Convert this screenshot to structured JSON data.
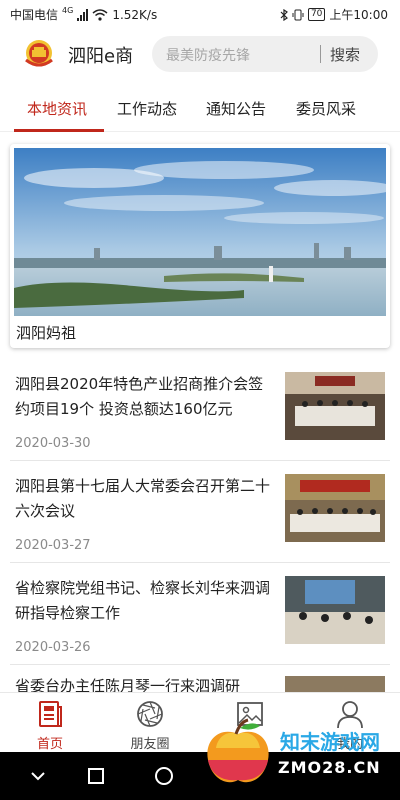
{
  "status_bar": {
    "carrier": "中国电信",
    "network": "4G",
    "speed": "1.52K/s",
    "battery": "70",
    "time": "上午10:00",
    "icons": [
      "signal-icon",
      "wifi-icon",
      "bluetooth-icon",
      "vibrate-icon",
      "battery-icon"
    ]
  },
  "header": {
    "app_name": "泗阳e商",
    "search_placeholder": "最美防疫先锋",
    "search_button": "搜索"
  },
  "tabs": [
    {
      "label": "本地资讯",
      "active": true
    },
    {
      "label": "工作动态",
      "active": false
    },
    {
      "label": "通知公告",
      "active": false
    },
    {
      "label": "委员风采",
      "active": false
    }
  ],
  "featured": {
    "caption": "泗阳妈祖"
  },
  "news": [
    {
      "title": "泗阳县2020年特色产业招商推介会签约项目19个 投资总额达160亿元",
      "date": "2020-03-30"
    },
    {
      "title": "泗阳县第十七届人大常委会召开第二十六次会议",
      "date": "2020-03-27"
    },
    {
      "title": "省检察院党组书记、检察长刘华来泗调研指导检察工作",
      "date": "2020-03-26"
    },
    {
      "title": "省委台办主任陈月琴一行来泗调研",
      "date": ""
    }
  ],
  "bottom_nav": [
    {
      "label": "首页",
      "icon": "home-doc-icon",
      "active": true
    },
    {
      "label": "朋友圈",
      "icon": "aperture-icon",
      "active": false
    },
    {
      "label": "图片",
      "icon": "image-icon",
      "active": false
    },
    {
      "label": "我的",
      "icon": "person-icon",
      "active": false
    }
  ],
  "watermark": {
    "line1": "知末游戏网",
    "line2": "ZMO28.CN"
  },
  "colors": {
    "accent": "#c0271b",
    "text": "#222222",
    "muted": "#8a8a8a"
  }
}
